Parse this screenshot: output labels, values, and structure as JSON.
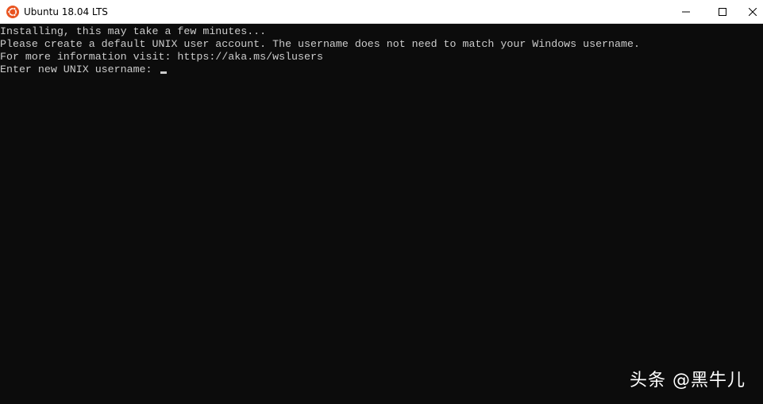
{
  "window": {
    "title": "Ubuntu 18.04 LTS",
    "icon": "ubuntu-logo-icon",
    "controls": {
      "minimize": "minimize-icon",
      "maximize": "maximize-icon",
      "close": "close-icon"
    }
  },
  "terminal": {
    "lines": [
      "Installing, this may take a few minutes...",
      "Please create a default UNIX user account. The username does not need to match your Windows username.",
      "For more information visit: https://aka.ms/wslusers",
      "Enter new UNIX username: "
    ],
    "input_value": ""
  },
  "watermark": {
    "text": "头条 @黑牛儿"
  },
  "colors": {
    "terminal_bg": "#0c0c0c",
    "terminal_fg": "#cccccc",
    "titlebar_bg": "#ffffff",
    "ubuntu_orange": "#e95420"
  }
}
